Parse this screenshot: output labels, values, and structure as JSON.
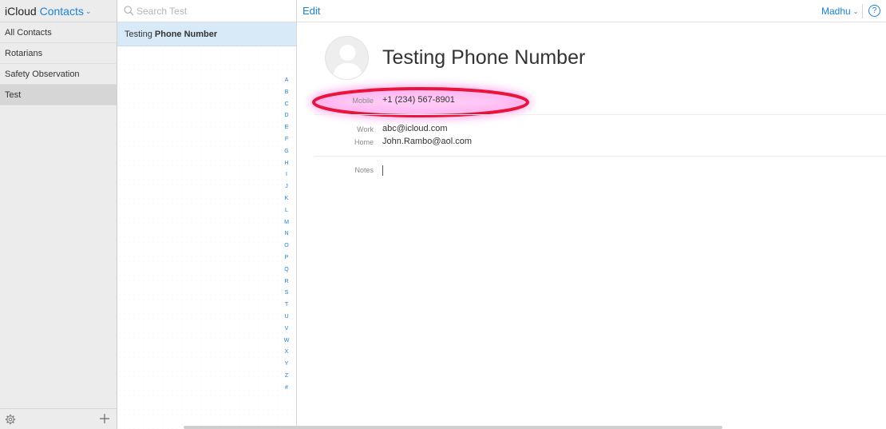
{
  "sidebar": {
    "app_name": "iCloud",
    "section": "Contacts",
    "groups": [
      {
        "label": "All Contacts"
      },
      {
        "label": "Rotarians"
      },
      {
        "label": "Safety Observation"
      },
      {
        "label": "Test"
      }
    ],
    "selected_group": "Test"
  },
  "list": {
    "search_placeholder": "Search Test",
    "contacts": [
      {
        "first": "Testing",
        "last": "Phone Number"
      }
    ],
    "index": [
      "A",
      "B",
      "C",
      "D",
      "E",
      "F",
      "G",
      "H",
      "I",
      "J",
      "K",
      "L",
      "M",
      "N",
      "O",
      "P",
      "Q",
      "R",
      "S",
      "T",
      "U",
      "V",
      "W",
      "X",
      "Y",
      "Z",
      "#"
    ]
  },
  "header": {
    "edit_label": "Edit",
    "user_name": "Madhu",
    "help_label": "?"
  },
  "detail": {
    "name": "Testing Phone Number",
    "fields": {
      "mobile": {
        "label": "Mobile",
        "value": "+1 (234) 567-8901"
      },
      "work": {
        "label": "Work",
        "value": "abc@icloud.com"
      },
      "home": {
        "label": "Home",
        "value": "John.Rambo@aol.com"
      },
      "notes": {
        "label": "Notes",
        "value": ""
      }
    }
  },
  "colors": {
    "accent": "#1a82d9",
    "highlight_ring": "#e8143c",
    "highlight_glow": "#ff4fd8"
  },
  "icons": [
    "chevron-down-icon",
    "gear-icon",
    "plus-icon",
    "search-icon",
    "help-icon",
    "avatar-silhouette-icon"
  ]
}
